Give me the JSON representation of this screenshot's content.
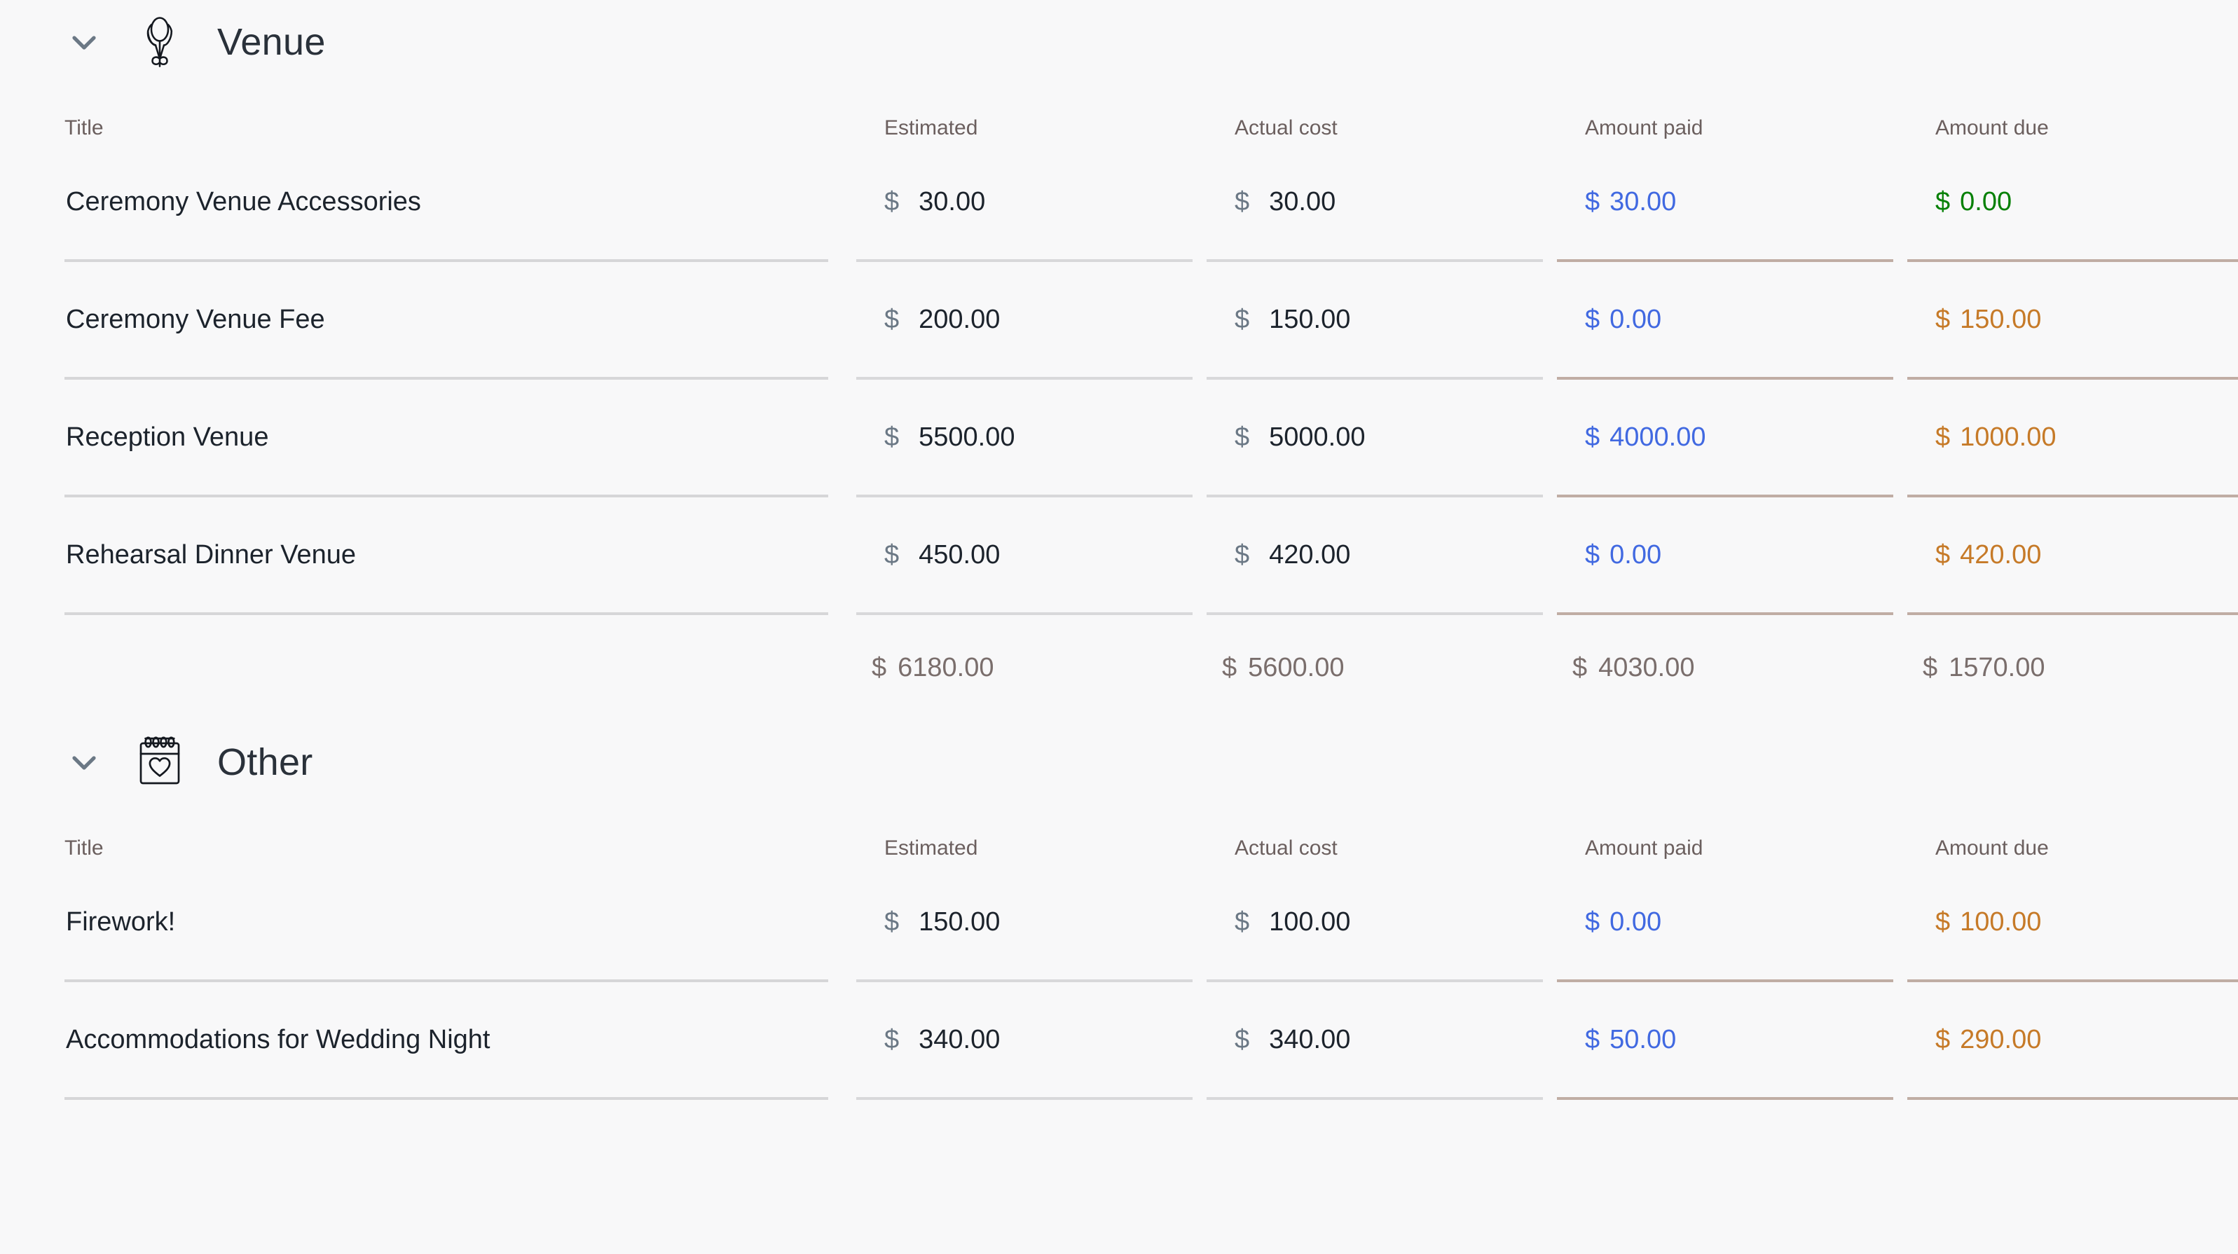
{
  "columns": {
    "title": "Title",
    "estimated": "Estimated",
    "actual": "Actual cost",
    "paid": "Amount paid",
    "due": "Amount due"
  },
  "currency_symbol": "$",
  "colors": {
    "background": "#f8f8f9",
    "title_text": "#1c232c",
    "header_label": "#6b5f5e",
    "currency_symbol": "#6b7885",
    "paid_blue": "#4169e1",
    "due_green": "#068006",
    "due_orange": "#c67a28",
    "total_text": "#7a6e6c",
    "rule_gray": "#d6d6d8",
    "rule_tan": "#c0ada4"
  },
  "sections": [
    {
      "id": "venue",
      "title": "Venue",
      "icon": "balloons-icon",
      "expanded": true,
      "chevron": "chevron-down-icon",
      "rows": [
        {
          "title": "Ceremony Venue Accessories",
          "estimated": "30.00",
          "actual": "30.00",
          "paid": "30.00",
          "due": "0.00",
          "due_state": "paid"
        },
        {
          "title": "Ceremony Venue Fee",
          "estimated": "200.00",
          "actual": "150.00",
          "paid": "0.00",
          "due": "150.00",
          "due_state": "owing"
        },
        {
          "title": "Reception Venue",
          "estimated": "5500.00",
          "actual": "5000.00",
          "paid": "4000.00",
          "due": "1000.00",
          "due_state": "owing"
        },
        {
          "title": "Rehearsal Dinner Venue",
          "estimated": "450.00",
          "actual": "420.00",
          "paid": "0.00",
          "due": "420.00",
          "due_state": "owing"
        }
      ],
      "totals": {
        "estimated": "6180.00",
        "actual": "5600.00",
        "paid": "4030.00",
        "due": "1570.00"
      }
    },
    {
      "id": "other",
      "title": "Other",
      "icon": "calendar-heart-icon",
      "expanded": true,
      "chevron": "chevron-down-icon",
      "rows": [
        {
          "title": "Firework!",
          "estimated": "150.00",
          "actual": "100.00",
          "paid": "0.00",
          "due": "100.00",
          "due_state": "owing"
        },
        {
          "title": "Accommodations for Wedding Night",
          "estimated": "340.00",
          "actual": "340.00",
          "paid": "50.00",
          "due": "290.00",
          "due_state": "owing"
        }
      ],
      "totals": null
    }
  ]
}
